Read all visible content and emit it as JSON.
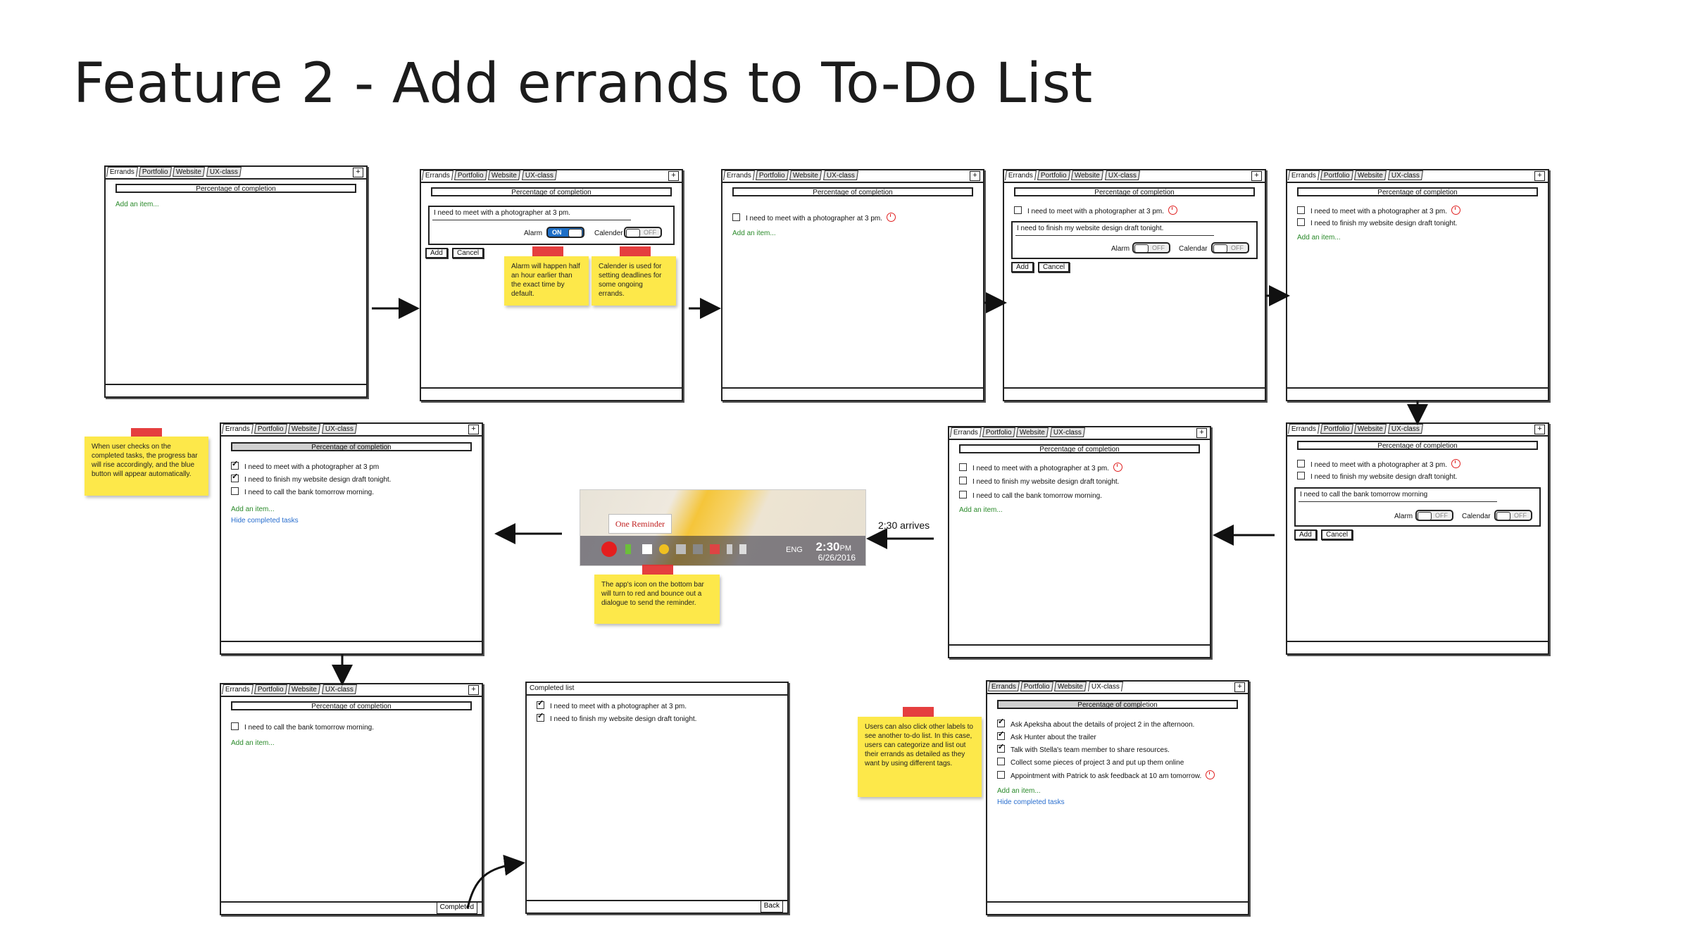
{
  "title": "Feature 2 - Add errands to To-Do List",
  "tabs": [
    "Errands",
    "Portfolio",
    "Website",
    "UX-class"
  ],
  "progress_label": "Percentage of completion",
  "add_item": "Add an item...",
  "hide_completed": "Hide completed tasks",
  "items": {
    "meet_pm": "I need to meet with a photographer at 3 pm.",
    "meet": "I need to meet with a photographer at 3 pm",
    "finish": "I need to finish my website design draft tonight.",
    "bank": "I need to call the bank tomorrow morning.",
    "bank_entry": "I need to call the bank tomorrow morning"
  },
  "controls": {
    "alarm": "Alarm",
    "calendar": "Calendar",
    "calender": "Calender",
    "on": "ON",
    "off": "OFF",
    "add": "Add",
    "cancel": "Cancel",
    "completed": "Completed",
    "back": "Back"
  },
  "completed_list": {
    "title": "Completed list",
    "items": [
      "I need to meet with a photographer at 3 pm.",
      "I need to finish my website design draft tonight."
    ]
  },
  "ux_items": [
    {
      "text": "Ask Apeksha about the details of project 2 in the afternoon.",
      "checked": true
    },
    {
      "text": "Ask Hunter about the trailer",
      "checked": true
    },
    {
      "text": "Talk with Stella's team member to share resources.",
      "checked": true
    },
    {
      "text": "Collect some pieces of project 3 and put up them online",
      "checked": false
    },
    {
      "text": "Appointment with Patrick to ask feedback at 10 am tomorrow.",
      "checked": false
    }
  ],
  "notes": {
    "alarm": "Alarm will happen half an hour earlier than the exact time by default.",
    "calendar": "Calender is used for setting deadlines for some ongoing errands.",
    "progress": "When user checks on the completed tasks, the progress bar will rise accordingly, and the blue button will appear automatically.",
    "icon": "The app's icon on the bottom bar will turn to red and bounce out a dialogue to send the reminder.",
    "labels": "Users can also click other labels to see another to-do list. In this case, users can categorize and list out their errands as detailed as they want by using different tags."
  },
  "arrow_label": "2:30 arrives",
  "taskbar": {
    "reminder": "One Reminder",
    "time": "2:30",
    "ampm": "PM",
    "date": "6/26/2016",
    "lang": "ENG"
  },
  "colors": {
    "note": "#fde84a",
    "tape": "#e22a2a",
    "toggle_on": "#1e6fc7",
    "link_green": "#2a8a2a",
    "link_blue": "#2a6fcf"
  }
}
